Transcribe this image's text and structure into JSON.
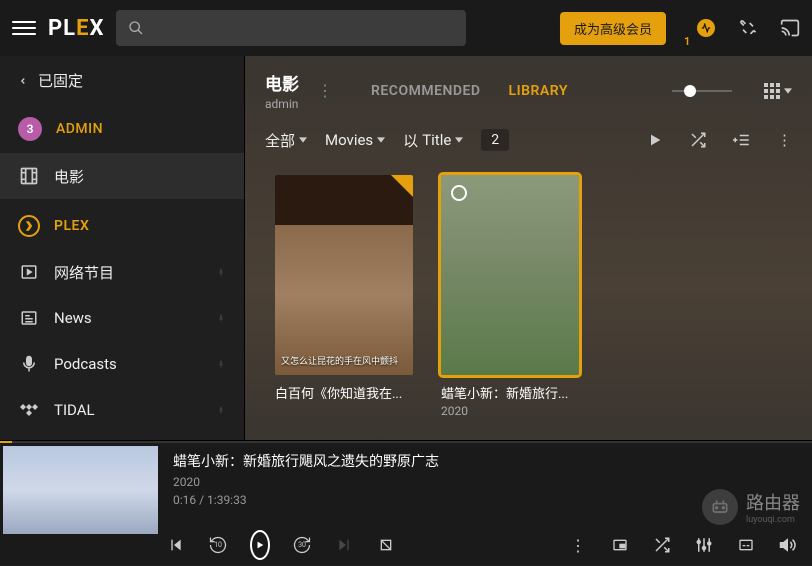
{
  "topbar": {
    "logo_p1": "PL",
    "logo_e": "E",
    "logo_x": "X",
    "premium_label": "成为高级会员",
    "badge": "1"
  },
  "sidebar": {
    "back_label": "已固定",
    "avatar_letter": "3",
    "user_name": "ADMIN",
    "items": [
      {
        "label": "电影",
        "icon": "film"
      },
      {
        "label": "网络节目",
        "icon": "play-box"
      },
      {
        "label": "News",
        "icon": "news"
      },
      {
        "label": "Podcasts",
        "icon": "mic"
      },
      {
        "label": "TIDAL",
        "icon": "tidal"
      }
    ],
    "plex_label": "PLEX"
  },
  "content": {
    "lib_title": "电影",
    "lib_sub": "admin",
    "tabs": [
      {
        "label": "RECOMMENDED",
        "active": false
      },
      {
        "label": "LIBRARY",
        "active": true
      }
    ],
    "filters": {
      "all": "全部",
      "type": "Movies",
      "sort_prefix": "以",
      "sort_field": "Title",
      "count": "2"
    },
    "posters": [
      {
        "title": "白百何《你知道我在...",
        "overlay": "又怎么让昆花的手在风中颤抖",
        "year": "",
        "selected": false,
        "flag": true
      },
      {
        "title": "蜡笔小新：新婚旅行...",
        "year": "2020",
        "selected": true,
        "flag": false
      }
    ]
  },
  "player": {
    "title": "蜡笔小新：新婚旅行飓风之遗失的野原广志",
    "year": "2020",
    "time": "0:16 / 1:39:33"
  },
  "watermark": {
    "text": "路由器",
    "sub": "luyouqi.com"
  }
}
